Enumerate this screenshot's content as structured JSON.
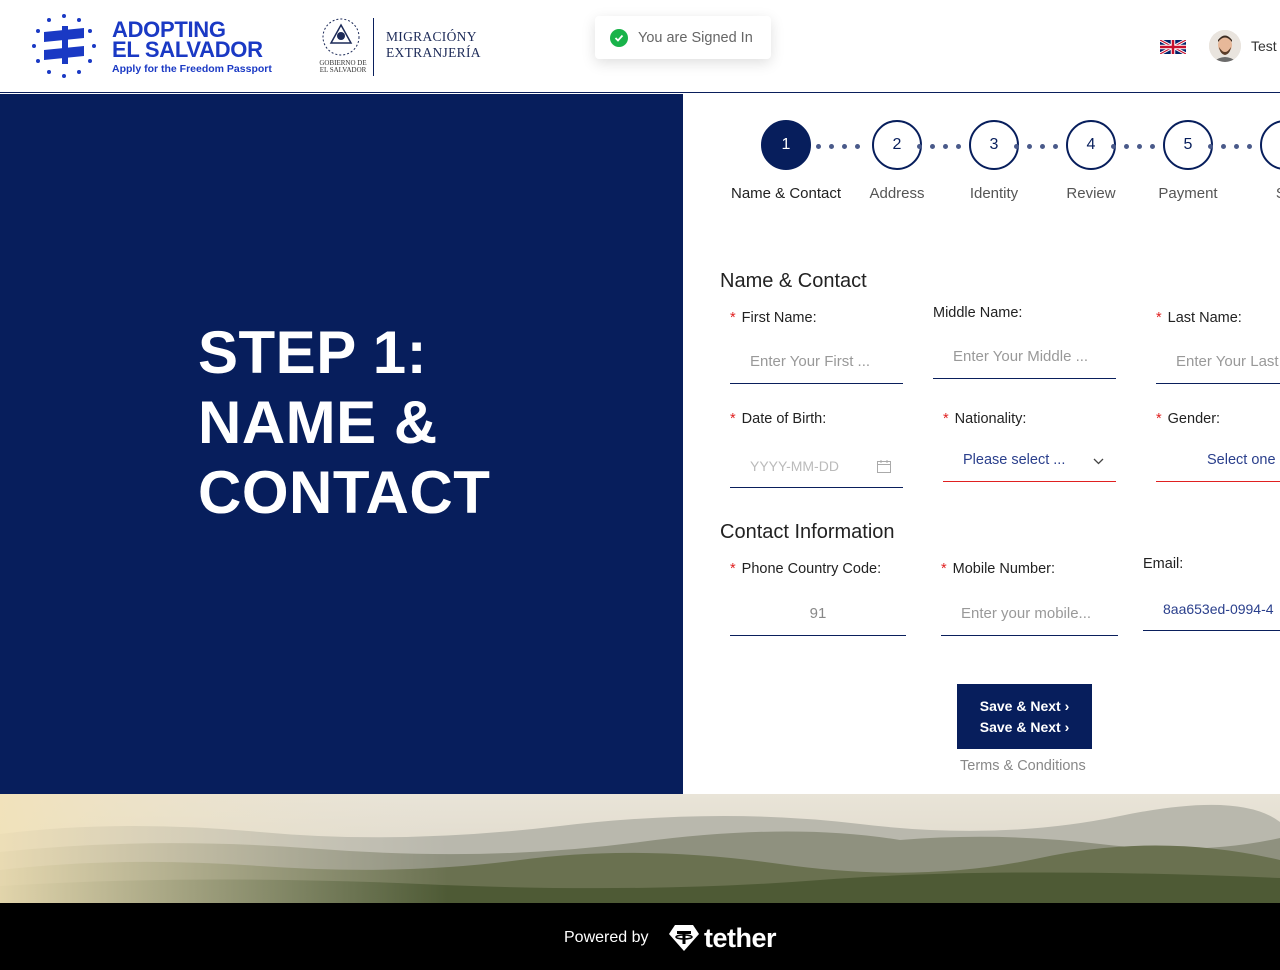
{
  "header": {
    "brand_title_line1": "ADOPTING",
    "brand_title_line2": "EL SALVADOR",
    "brand_subtitle": "Apply for the Freedom Passport",
    "gov_seal_text_line1": "GOBIERNO DE",
    "gov_seal_text_line2": "EL SALVADOR",
    "gov_name_line1": "MIGRACIÓNY",
    "gov_name_line2": "EXTRANJERÍA",
    "toast": "You are Signed In",
    "user_name": "Test",
    "language_icon": "uk-flag-icon"
  },
  "left_panel": {
    "line1": "STEP 1:",
    "line2": "NAME &",
    "line3": "CONTACT"
  },
  "stepper": {
    "steps": [
      {
        "number": "1",
        "label": "Name & Contact"
      },
      {
        "number": "2",
        "label": "Address"
      },
      {
        "number": "3",
        "label": "Identity"
      },
      {
        "number": "4",
        "label": "Review"
      },
      {
        "number": "5",
        "label": "Payment"
      },
      {
        "number": "",
        "label": "Su"
      }
    ],
    "active_index": 0
  },
  "form": {
    "section1_title": "Name & Contact",
    "first_name": {
      "label": "First Name",
      "placeholder": "Enter Your First ..."
    },
    "middle_name": {
      "label": "Middle Name",
      "placeholder": "Enter Your Middle ..."
    },
    "last_name": {
      "label": "Last Name",
      "placeholder": "Enter Your Last"
    },
    "dob": {
      "label": "Date of Birth",
      "placeholder": "YYYY-MM-DD"
    },
    "nationality": {
      "label": "Nationality",
      "value": "Please select ..."
    },
    "gender": {
      "label": "Gender",
      "value": "Select one"
    },
    "section2_title": "Contact Information",
    "phone_code": {
      "label": "Phone Country Code",
      "value": "91"
    },
    "mobile": {
      "label": "Mobile Number",
      "placeholder": "Enter your mobile..."
    },
    "email": {
      "label": "Email",
      "value": "8aa653ed-0994-4"
    },
    "label_colon": ":",
    "required_mark": "*",
    "save_label": "Save & Next",
    "save_arrow": "›",
    "terms": "Terms & Conditions"
  },
  "footer": {
    "powered_by": "Powered by",
    "tether": "tether"
  },
  "colors": {
    "navy": "#071e5c",
    "brand_blue": "#1a39c4",
    "required_red": "#e02020",
    "success_green": "#19b34a"
  }
}
